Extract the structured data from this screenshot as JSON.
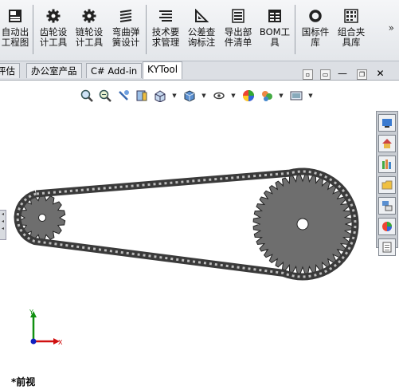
{
  "ribbon": {
    "buttons": [
      {
        "label": "自动出\n工程图",
        "icon": "drawing-icon"
      },
      {
        "label": "齿轮设\n计工具",
        "icon": "gear-icon"
      },
      {
        "label": "链轮设\n计工具",
        "icon": "sprocket-icon"
      },
      {
        "label": "弯曲弹\n簧设计",
        "icon": "spring-icon"
      },
      {
        "label": "技术要\n求管理",
        "icon": "list-icon"
      },
      {
        "label": "公差查\n询标注",
        "icon": "tolerance-icon"
      },
      {
        "label": "导出部\n件清单",
        "icon": "export-list-icon"
      },
      {
        "label": "BOM工\n具",
        "icon": "bom-table-icon"
      },
      {
        "label": "国标件\n库",
        "icon": "ring-icon"
      },
      {
        "label": "组合夹\n具库",
        "icon": "fixture-grid-icon"
      }
    ],
    "more": "»"
  },
  "tabs": [
    {
      "label": "评估",
      "active": false
    },
    {
      "label": "办公室产品",
      "active": false
    },
    {
      "label": "C# Add-in",
      "active": false
    },
    {
      "label": "KYTool",
      "active": true
    }
  ],
  "window_controls": [
    "restore-view-icon",
    "tile-view-icon",
    "minimize-icon",
    "maximize-icon",
    "close-icon"
  ],
  "view_toolbar": [
    "zoom-to-fit-icon",
    "zoom-area-icon",
    "previous-view-icon",
    "section-view-icon",
    "view-orientation-icon",
    "display-style-icon",
    "hide-show-icon",
    "edit-appearance-icon",
    "apply-scene-icon",
    "view-settings-icon"
  ],
  "task_pane": [
    "solidworks-resources-icon",
    "home-icon",
    "design-library-icon",
    "file-explorer-icon",
    "view-palette-icon",
    "appearances-icon",
    "custom-properties-icon"
  ],
  "triad": {
    "y": "Y",
    "x": "X"
  },
  "view_label": "*前视",
  "colors": {
    "chain": "#3a3a3a",
    "sprocket": "#6e6e6e",
    "axis_x": "#d01010",
    "axis_y": "#109010",
    "axis_z": "#1020c0"
  }
}
